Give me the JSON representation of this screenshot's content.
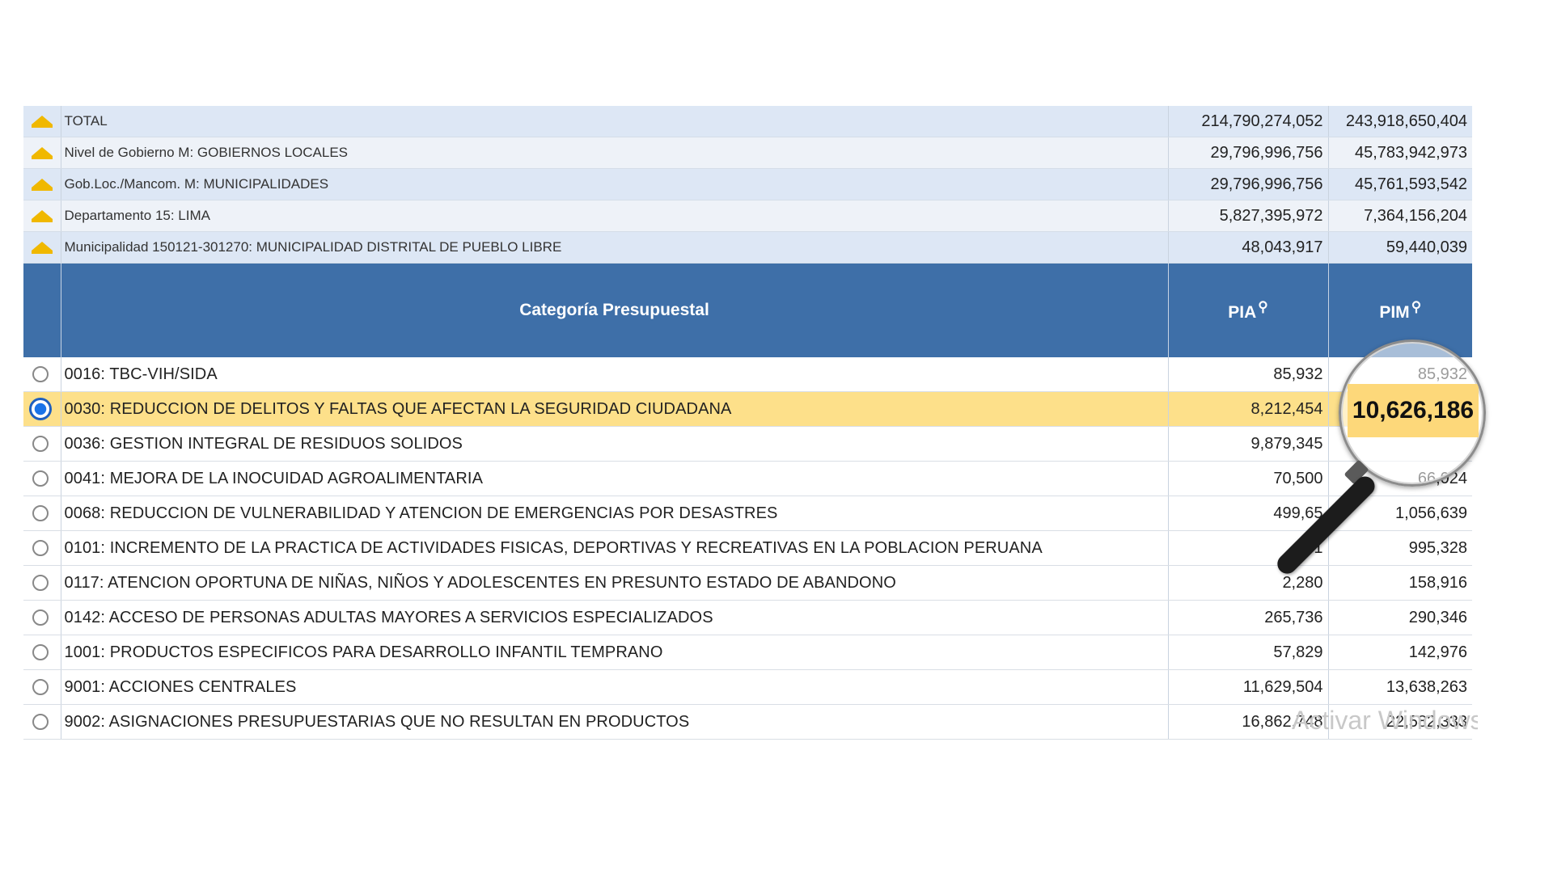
{
  "summary_rows": [
    {
      "label": "TOTAL",
      "pia": "214,790,274,052",
      "pim": "243,918,650,404"
    },
    {
      "label": "Nivel de Gobierno M: GOBIERNOS LOCALES",
      "pia": "29,796,996,756",
      "pim": "45,783,942,973"
    },
    {
      "label": "Gob.Loc./Mancom. M: MUNICIPALIDADES",
      "pia": "29,796,996,756",
      "pim": "45,761,593,542"
    },
    {
      "label": "Departamento 15: LIMA",
      "pia": "5,827,395,972",
      "pim": "7,364,156,204"
    },
    {
      "label": "Municipalidad 150121-301270: MUNICIPALIDAD DISTRITAL DE PUEBLO LIBRE",
      "pia": "48,043,917",
      "pim": "59,440,039"
    }
  ],
  "header": {
    "category": "Categoría Presupuestal",
    "pia": "PIA",
    "pim": "PIM"
  },
  "rows": [
    {
      "label": "0016: TBC-VIH/SIDA",
      "pia": "85,932",
      "pim": "85,932",
      "selected": false
    },
    {
      "label": "0030: REDUCCION DE DELITOS Y FALTAS QUE AFECTAN LA SEGURIDAD CIUDADANA",
      "pia": "8,212,454",
      "pim": "",
      "selected": true
    },
    {
      "label": "0036: GESTION INTEGRAL DE RESIDUOS SOLIDOS",
      "pia": "9,879,345",
      "pim": "",
      "selected": false
    },
    {
      "label": "0041: MEJORA DE LA INOCUIDAD AGROALIMENTARIA",
      "pia": "70,500",
      "pim": "66,024",
      "selected": false
    },
    {
      "label": "0068: REDUCCION DE VULNERABILIDAD Y ATENCION DE EMERGENCIAS POR DESASTRES",
      "pia": "499,65",
      "pim": "1,056,639",
      "selected": false
    },
    {
      "label": "0101: INCREMENTO DE LA PRACTICA DE ACTIVIDADES FISICAS, DEPORTIVAS Y RECREATIVAS EN LA POBLACION PERUANA",
      "pia": "31",
      "pim": "995,328",
      "selected": false
    },
    {
      "label": "0117: ATENCION OPORTUNA DE NIÑAS, NIÑOS Y ADOLESCENTES EN PRESUNTO ESTADO DE ABANDONO",
      "pia": "2,280",
      "pim": "158,916",
      "selected": false
    },
    {
      "label": "0142: ACCESO DE PERSONAS ADULTAS MAYORES A SERVICIOS ESPECIALIZADOS",
      "pia": "265,736",
      "pim": "290,346",
      "selected": false
    },
    {
      "label": "1001: PRODUCTOS ESPECIFICOS PARA DESARROLLO INFANTIL TEMPRANO",
      "pia": "57,829",
      "pim": "142,976",
      "selected": false
    },
    {
      "label": "9001: ACCIONES CENTRALES",
      "pia": "11,629,504",
      "pim": "13,638,263",
      "selected": false
    },
    {
      "label": "9002: ASIGNACIONES PRESUPUESTARIAS QUE NO RESULTAN EN PRODUCTOS",
      "pia": "16,862,748",
      "pim": "22,582,333",
      "selected": false
    }
  ],
  "magnifier": {
    "value": "10,626,186"
  },
  "watermark": "Activar Windows",
  "icons": {
    "summary": "caret-up-icon",
    "header": "map-pin-icon",
    "row": "radio-button-icon"
  },
  "colors": {
    "header_bg": "#3e6fa8",
    "selected_row": "#fde08a",
    "caret": "#f0b800",
    "magnifier_fill": "#fdd87a"
  }
}
